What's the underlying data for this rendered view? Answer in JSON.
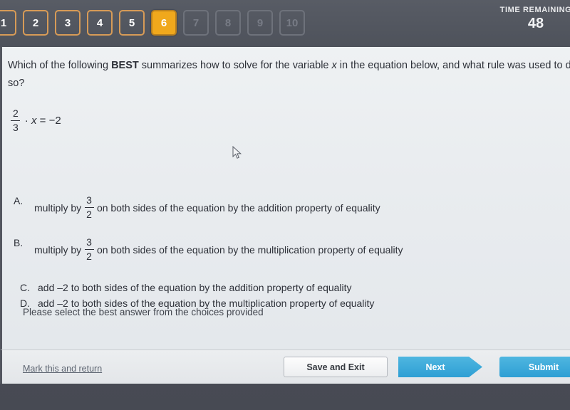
{
  "topbar": {
    "question_buttons": [
      {
        "label": "1",
        "state": "done"
      },
      {
        "label": "2",
        "state": "done"
      },
      {
        "label": "3",
        "state": "done"
      },
      {
        "label": "4",
        "state": "done"
      },
      {
        "label": "5",
        "state": "done"
      },
      {
        "label": "6",
        "state": "current"
      },
      {
        "label": "7",
        "state": "locked"
      },
      {
        "label": "8",
        "state": "locked"
      },
      {
        "label": "9",
        "state": "locked"
      },
      {
        "label": "10",
        "state": "locked"
      }
    ],
    "timer_label": "TIME REMAINING",
    "timer_value": "48",
    "active_color": "#f0a81c",
    "done_border_color": "#d79b57",
    "locked_color": "#777b85"
  },
  "question": {
    "text_part1": "Which of the following ",
    "bold": "BEST",
    "text_part2": " summarizes how to solve for the variable ",
    "italic_var": "x",
    "text_part3": " in the equation below, and what rule was used to do so?"
  },
  "equation": {
    "numerator": "2",
    "denominator": "3",
    "rest_prefix": "·",
    "variable": "x",
    "rest_suffix": "= −2"
  },
  "choices": [
    {
      "letter": "A.",
      "prefix": "multiply by",
      "frac_num": "3",
      "frac_den": "2",
      "suffix": "on both sides of the equation by the addition property of equality",
      "has_fraction": true
    },
    {
      "letter": "B.",
      "prefix": "multiply by",
      "frac_num": "3",
      "frac_den": "2",
      "suffix": "on both sides of the equation by the multiplication property of equality",
      "has_fraction": true
    },
    {
      "letter": "C.",
      "text": "add –2 to both sides of the equation by the addition property of equality",
      "has_fraction": false
    },
    {
      "letter": "D.",
      "text": "add –2 to both sides of the equation by the multiplication property of equality",
      "has_fraction": false
    }
  ],
  "prompt": "Please select the best answer from the choices provided",
  "footer": {
    "mark_link": "Mark this and return",
    "save_label": "Save and Exit",
    "next_label": "Next",
    "submit_label": "Submit",
    "button_accent": "#2e9fd4"
  }
}
